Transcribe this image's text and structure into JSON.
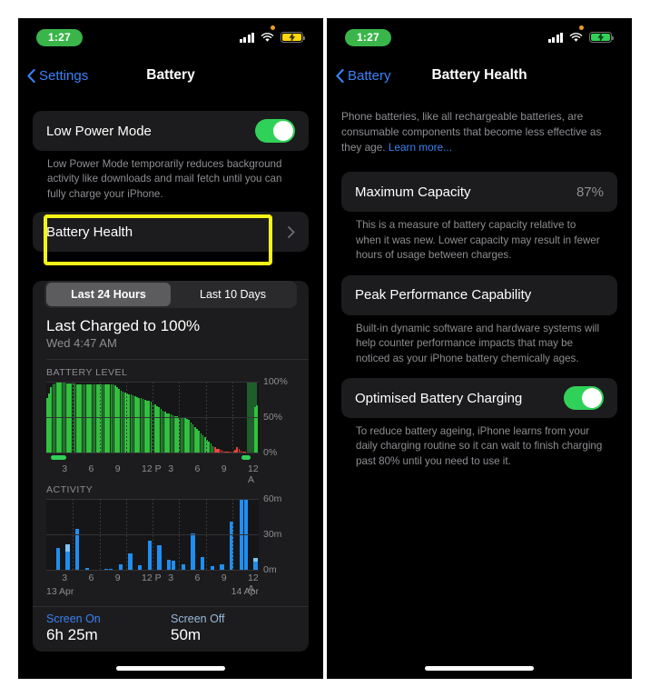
{
  "theme": {
    "accent_blue": "#3b82f6",
    "toggle_green": "#30d158",
    "highlight_yellow": "#f5f517",
    "battery_green": "#31c13f",
    "battery_red": "#e8453c",
    "activity_blue": "#1f8ef1",
    "card_bg": "#1c1c1e",
    "secondary_text": "#8e8e93"
  },
  "left_panel": {
    "status_bar": {
      "time": "1:27",
      "signal_icon": "cellular-signal-icon",
      "wifi_icon": "wifi-icon",
      "battery_icon": "battery-charging-lowpower-icon",
      "battery_color": "#ffd60a",
      "recording_dot": "orange-privacy-dot"
    },
    "nav": {
      "back_label": "Settings",
      "back_icon": "chevron-left-icon",
      "title": "Battery"
    },
    "low_power_mode": {
      "label": "Low Power Mode",
      "toggle_on": true,
      "footnote": "Low Power Mode temporarily reduces background activity like downloads and mail fetch until you can fully charge your iPhone."
    },
    "battery_health_row": {
      "label": "Battery Health",
      "disclosure_icon": "chevron-right-icon",
      "highlighted": true
    },
    "segmented": {
      "options": [
        "Last 24 Hours",
        "Last 10 Days"
      ],
      "selected_index": 0
    },
    "last_charged": {
      "title": "Last Charged to 100%",
      "subtitle": "Wed 4:47 AM"
    },
    "screen_usage": {
      "on_label": "Screen On",
      "on_value": "6h 25m",
      "off_label": "Screen Off",
      "off_value": "50m"
    }
  },
  "right_panel": {
    "status_bar": {
      "time": "1:27",
      "signal_icon": "cellular-signal-icon",
      "wifi_icon": "wifi-icon",
      "battery_icon": "battery-charging-icon",
      "battery_color": "#30d158",
      "recording_dot": "orange-privacy-dot"
    },
    "nav": {
      "back_label": "Battery",
      "back_icon": "chevron-left-icon",
      "title": "Battery Health"
    },
    "intro": {
      "text": "Phone batteries, like all rechargeable batteries, are consumable components that become less effective as they age. ",
      "link": "Learn more..."
    },
    "maximum_capacity": {
      "label": "Maximum Capacity",
      "value": "87%",
      "footnote": "This is a measure of battery capacity relative to when it was new. Lower capacity may result in fewer hours of usage between charges."
    },
    "peak_performance": {
      "label": "Peak Performance Capability",
      "footnote": "Built-in dynamic software and hardware systems will help counter performance impacts that may be noticed as your iPhone battery chemically ages."
    },
    "optimised_charging": {
      "label": "Optimised Battery Charging",
      "toggle_on": true,
      "footnote": "To reduce battery ageing, iPhone learns from your daily charging routine so it can wait to finish charging past 80% until you need to use it."
    }
  },
  "chart_data": [
    {
      "type": "bar",
      "title": "BATTERY LEVEL",
      "id": "battery-level",
      "ylabel": "",
      "xlabel": "",
      "ylim": [
        0,
        100
      ],
      "yticks": [
        0,
        50,
        100
      ],
      "ytick_labels": [
        "0%",
        "50%",
        "100%"
      ],
      "xticks": [
        3,
        6,
        9,
        12,
        15,
        18,
        21,
        24
      ],
      "xtick_labels": [
        "3",
        "6",
        "9",
        "12 P",
        "3",
        "6",
        "9",
        "12 A"
      ],
      "date_start": "13 Apr",
      "date_end": "14 Apr",
      "values": [
        78,
        84,
        93,
        96,
        98,
        100,
        100,
        99,
        99,
        99,
        98,
        98,
        98,
        98,
        98,
        97,
        97,
        97,
        97,
        96,
        96,
        96,
        96,
        96,
        96,
        96,
        96,
        96,
        96,
        96,
        96,
        96,
        96,
        96,
        95,
        93,
        90,
        88,
        86,
        85,
        84,
        83,
        82,
        81,
        80,
        79,
        78,
        77,
        76,
        75,
        74,
        73,
        72,
        70,
        68,
        66,
        64,
        62,
        60,
        58,
        56,
        55,
        54,
        53,
        52,
        52,
        51,
        51,
        51,
        50,
        48,
        46,
        43,
        40,
        37,
        34,
        31,
        28,
        25,
        22,
        19,
        16,
        13,
        10,
        8,
        6,
        5,
        4,
        3,
        2,
        2,
        1,
        1,
        2,
        4,
        8,
        6,
        3,
        2,
        1,
        0,
        0,
        0,
        0,
        65,
        67
      ],
      "low_battery_from_index": 84,
      "charging_region": {
        "start_index": 100,
        "end_index": 104
      },
      "charging_segments": [
        {
          "start_pct": 2.0,
          "width_pct": 7.5
        },
        {
          "start_pct": 92.0,
          "width_pct": 4.0
        }
      ],
      "legend": [
        "battery level",
        "low battery (red)",
        "charging (green bar)"
      ]
    },
    {
      "type": "bar",
      "title": "ACTIVITY",
      "id": "activity",
      "ylabel": "",
      "xlabel": "",
      "ylim": [
        0,
        60
      ],
      "yticks": [
        0,
        30,
        60
      ],
      "ytick_labels": [
        "0m",
        "30m",
        "60m"
      ],
      "xticks": [
        3,
        6,
        9,
        12,
        15,
        18,
        21,
        24
      ],
      "xtick_labels": [
        "3",
        "6",
        "9",
        "12 P",
        "3",
        "6",
        "9",
        "12 A"
      ],
      "date_start": "13 Apr",
      "date_end": "14 Apr",
      "values": [
        0,
        0,
        19,
        0,
        22,
        0,
        35,
        0,
        2,
        0,
        0,
        0,
        1,
        1,
        0,
        5,
        0,
        14,
        0,
        4,
        0,
        25,
        0,
        21,
        0,
        9,
        8,
        0,
        5,
        0,
        31,
        0,
        11,
        0,
        3,
        0,
        5,
        0,
        41,
        0,
        60,
        60,
        0,
        10
      ],
      "values_dark": [
        0,
        0,
        0,
        0,
        6,
        0,
        0,
        0,
        0,
        0,
        0,
        0,
        0,
        0,
        0,
        0,
        0,
        0,
        0,
        0,
        0,
        0,
        0,
        0,
        0,
        0,
        0,
        0,
        0,
        0,
        0,
        0,
        0,
        0,
        0,
        0,
        0,
        0,
        0,
        0,
        0,
        0,
        0,
        3
      ]
    }
  ]
}
